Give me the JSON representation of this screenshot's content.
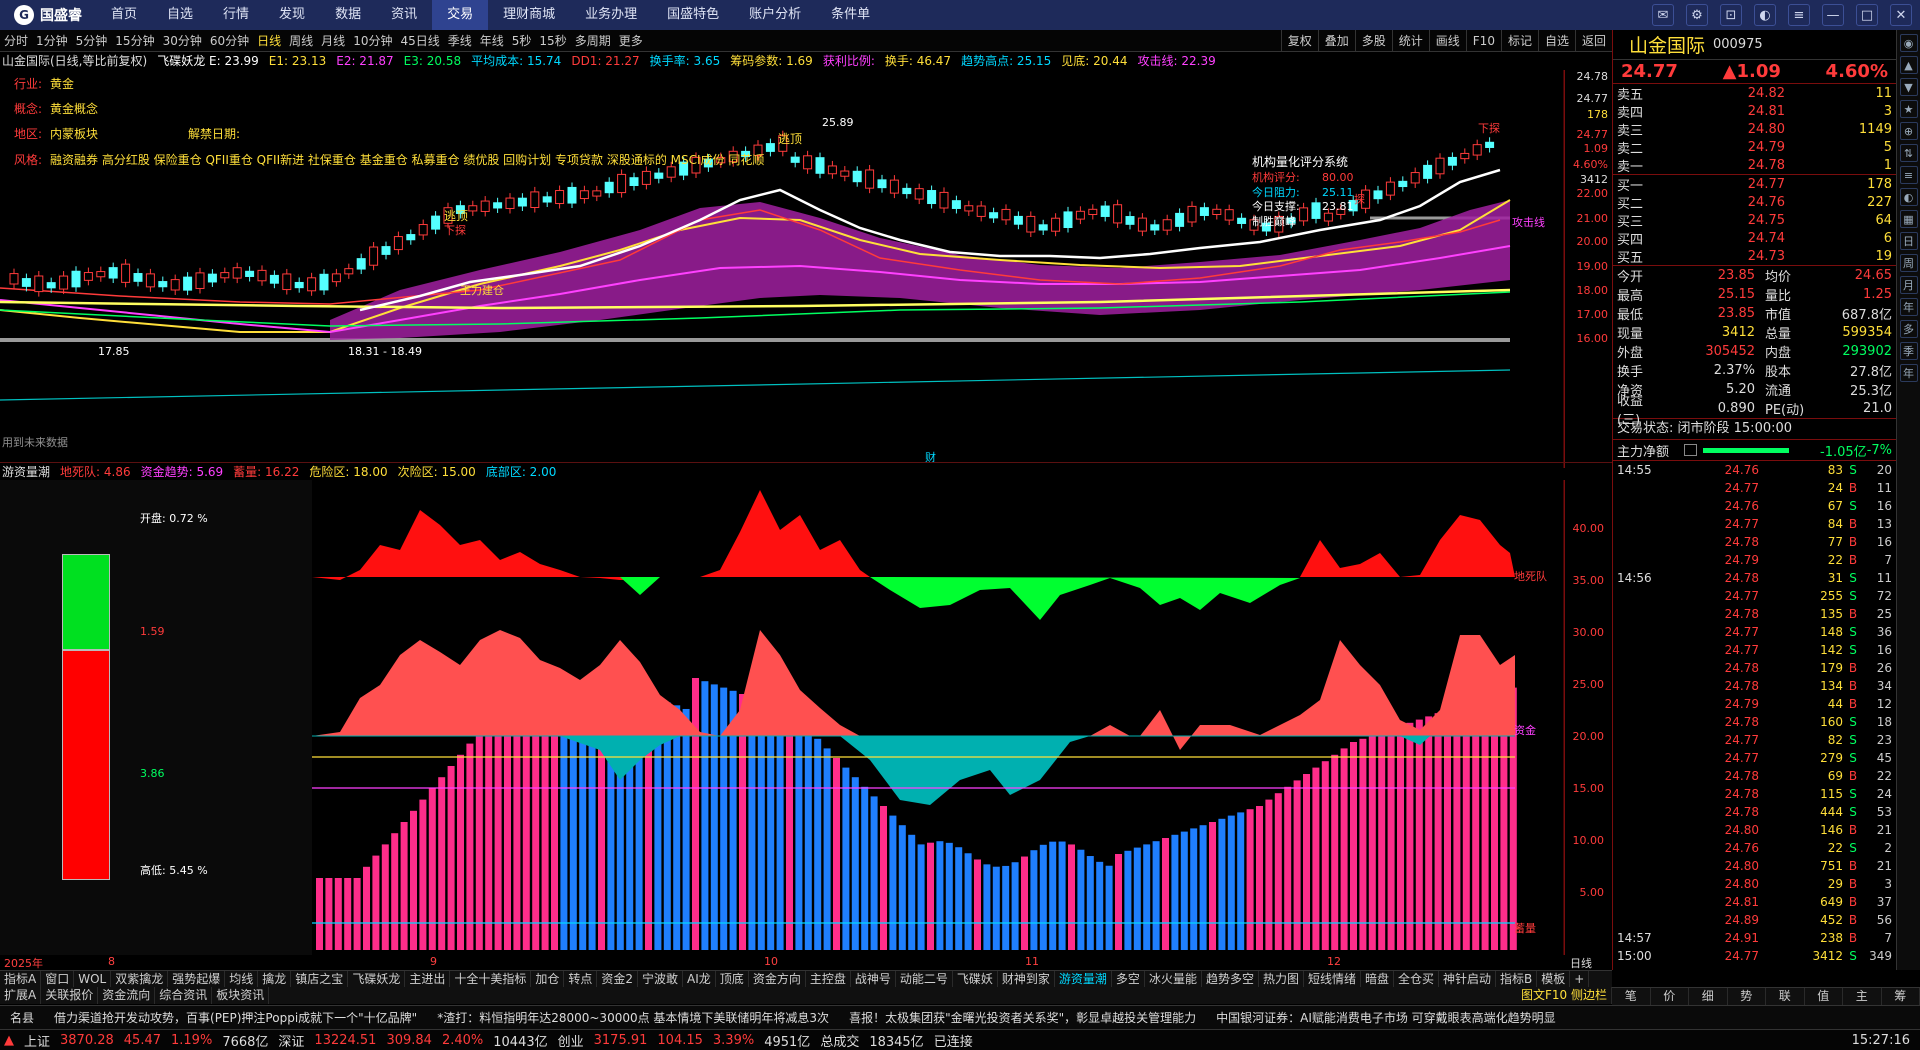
{
  "app": {
    "logo_text": "国盛睿",
    "nav": [
      "首页",
      "自选",
      "行情",
      "发现",
      "数据",
      "资讯",
      "交易",
      "理财商城",
      "业务办理",
      "国盛特色",
      "账户分析",
      "条件单"
    ],
    "nav_active": "交易"
  },
  "periods": [
    "分时",
    "1分钟",
    "5分钟",
    "15分钟",
    "30分钟",
    "60分钟",
    "日线",
    "周线",
    "月线",
    "10分钟",
    "45日线",
    "季线",
    "年线",
    "5秒",
    "15秒",
    "多周期",
    "更多"
  ],
  "period_active": "日线",
  "chart_tools": [
    "复权",
    "叠加",
    "多股",
    "统计",
    "画线",
    "F10",
    "标记",
    "自选",
    "返回"
  ],
  "indicator_line": [
    {
      "text": "山金国际(日线,等比前复权)",
      "color": "#dddddd"
    },
    {
      "text": "飞碟妖龙 E: 23.99",
      "color": "#ffffff"
    },
    {
      "text": "E1: 23.13",
      "color": "#ffdf3a"
    },
    {
      "text": "E2: 21.87",
      "color": "#ff40ff"
    },
    {
      "text": "E3: 20.58",
      "color": "#00ff60"
    },
    {
      "text": "平均成本: 15.74",
      "color": "#00d8ff"
    },
    {
      "text": "DD1: 21.27",
      "color": "#ff3b3b"
    },
    {
      "text": "换手率: 3.65",
      "color": "#00d8ff"
    },
    {
      "text": "筹码参数: 1.69",
      "color": "#ffdf3a"
    },
    {
      "text": "获利比例:",
      "color": "#ff40ff"
    },
    {
      "text": "换手: 46.47",
      "color": "#ffdf3a"
    },
    {
      "text": "趋势高点: 25.15",
      "color": "#00d8ff"
    },
    {
      "text": "见底: 20.44",
      "color": "#ffdf3a"
    },
    {
      "text": "攻击线: 22.39",
      "color": "#ff40ff"
    }
  ],
  "overlay_info": {
    "industry_label": "行业:",
    "industry": "黄金",
    "concept_label": "概念:",
    "concept": "黄金概念",
    "region_label": "地区:",
    "region": "内蒙板块",
    "unban_label": "解禁日期:",
    "style_label": "风格:",
    "style": "融资融券 高分红股 保险重仓 QFII重仓 QFII新进 社保重仓 基金重仓 私募重仓 绩优股 回购计划 专项贷款 深股通标的 MSCI成份 同花顺"
  },
  "rating_box": {
    "title": "机构量化评分系统",
    "score_label": "机构评分:",
    "score": "80.00",
    "resist_label": "今日阻力:",
    "resist": "25.11",
    "support_label": "今日支撑:",
    "support": "23.81",
    "note": "制胜巅峰"
  },
  "chart_labels": {
    "low": "17.85",
    "range": "18.31 - 18.49",
    "high": "25.89",
    "zhuli": "王力建仓",
    "fin_marker": "财",
    "attack": "攻击线",
    "escape1": "逃顶",
    "escape2": "逃顶",
    "down1": "下探",
    "down2": "下探",
    "dip": "探",
    "bottom_note": "用到未来数据"
  },
  "price_axis": [
    "24.78",
    "24.77",
    "178",
    "24.77",
    "1.09",
    "4.60%",
    "3412",
    "22.00",
    "21.00",
    "20.00",
    "19.00",
    "18.00",
    "17.00",
    "16.00"
  ],
  "sub_indicator": [
    {
      "text": "游资量潮",
      "color": "#dddddd"
    },
    {
      "text": "地死队: 4.86",
      "color": "#ff3b3b"
    },
    {
      "text": "资金趋势: 5.69",
      "color": "#ff40ff"
    },
    {
      "text": "蓄量: 16.22",
      "color": "#ff3b3b"
    },
    {
      "text": "危险区: 18.00",
      "color": "#ffdf3a"
    },
    {
      "text": "次险区: 15.00",
      "color": "#ffdf3a"
    },
    {
      "text": "底部区: 2.00",
      "color": "#00d8ff"
    }
  ],
  "sub_axis": [
    "40.00",
    "35.00",
    "30.00",
    "25.00",
    "20.00",
    "15.00",
    "10.00",
    "5.00"
  ],
  "sub_labels": {
    "a": "地死队",
    "b": "资金",
    "c": "蓄量"
  },
  "gauge": {
    "open_label": "开盘:",
    "open": "0.72 %",
    "top": "1.59",
    "bottom": "3.86",
    "high_label": "高低:",
    "high": "5.45 %"
  },
  "x_axis": [
    "2025年",
    "8",
    "9",
    "10",
    "11",
    "12",
    "日线"
  ],
  "tabs1": [
    "指标A",
    "窗口",
    "WOL",
    "双紫擒龙",
    "强势起爆",
    "均线",
    "擒龙",
    "镇店之宝",
    "飞碟妖龙",
    "主进出",
    "十全十美指标",
    "加仓",
    "转点",
    "资金2",
    "宁波敢",
    "AI龙",
    "顶底",
    "资金方向",
    "主控盘",
    "战神号",
    "动能二号",
    "飞碟妖",
    "财神到家",
    "游资量潮",
    "多空",
    "冰火量能",
    "趋势多空",
    "热力图",
    "短线情绪",
    "暗盘",
    "全仓买",
    "神针启动",
    "指标B",
    "模板",
    "+"
  ],
  "tabs1_active": "游资量潮",
  "tabs2": [
    "扩展A",
    "关联报价",
    "资金流向",
    "综合资讯",
    "板块资讯"
  ],
  "tabs2_right": "图文F10 侧边栏",
  "news": [
    "借力渠道抢开发动攻势，百事(PEP)押注Poppi成就下一个\"十亿品牌\"",
    "*渣打：料恒指明年达28000~30000点 基本情境下美联储明年将减息3次",
    "喜报！太极集团获\"金曙光投资者关系奖\"，彰显卓越投关管理能力",
    "中国银河证券：AI赋能消费电子市场 可穿戴眼表高端化趋势明显"
  ],
  "news_prefix": "名县",
  "status": {
    "sh_label": "上证",
    "sh": "3870.28",
    "sh_chg": "45.47",
    "sh_pct": "1.19%",
    "sh_amt": "7668亿",
    "sz_label": "深证",
    "sz": "13224.51",
    "sz_chg": "309.84",
    "sz_pct": "2.40%",
    "sz_amt": "10443亿",
    "cy_label": "创业",
    "cy": "3175.91",
    "cy_chg": "104.15",
    "cy_pct": "3.39%",
    "cy_amt": "4951亿",
    "total_label": "总成交",
    "total": "18345亿",
    "conn": "已连接",
    "time": "15:27:16"
  },
  "stock": {
    "name": "山金国际",
    "code": "000975",
    "price": "24.77",
    "chg": "▲1.09",
    "pct": "4.60%"
  },
  "orderbook_sell": [
    {
      "lbl": "卖五",
      "px": "24.82",
      "vol": "11"
    },
    {
      "lbl": "卖四",
      "px": "24.81",
      "vol": "3"
    },
    {
      "lbl": "卖三",
      "px": "24.80",
      "vol": "1149"
    },
    {
      "lbl": "卖二",
      "px": "24.79",
      "vol": "5"
    },
    {
      "lbl": "卖一",
      "px": "24.78",
      "vol": "1"
    }
  ],
  "orderbook_buy": [
    {
      "lbl": "买一",
      "px": "24.77",
      "vol": "178"
    },
    {
      "lbl": "买二",
      "px": "24.76",
      "vol": "227"
    },
    {
      "lbl": "买三",
      "px": "24.75",
      "vol": "64"
    },
    {
      "lbl": "买四",
      "px": "24.74",
      "vol": "6"
    },
    {
      "lbl": "买五",
      "px": "24.73",
      "vol": "19"
    }
  ],
  "stats": [
    {
      "k": "今开",
      "v": "23.85",
      "vc": "#ff3b3b",
      "k2": "均价",
      "v2": "24.65",
      "v2c": "#ff3b3b"
    },
    {
      "k": "最高",
      "v": "25.15",
      "vc": "#ff3b3b",
      "k2": "量比",
      "v2": "1.25",
      "v2c": "#ff3b3b"
    },
    {
      "k": "最低",
      "v": "23.85",
      "vc": "#ff3b3b",
      "k2": "市值",
      "v2": "687.8亿",
      "v2c": "#dddddd"
    },
    {
      "k": "现量",
      "v": "3412",
      "vc": "#ffdf3a",
      "k2": "总量",
      "v2": "599354",
      "v2c": "#ffdf3a"
    },
    {
      "k": "外盘",
      "v": "305452",
      "vc": "#ff3b3b",
      "k2": "内盘",
      "v2": "293902",
      "v2c": "#00ff60"
    },
    {
      "k": "换手",
      "v": "2.37%",
      "vc": "#dddddd",
      "k2": "股本",
      "v2": "27.8亿",
      "v2c": "#dddddd"
    },
    {
      "k": "净资",
      "v": "5.20",
      "vc": "#dddddd",
      "k2": "流通",
      "v2": "25.3亿",
      "v2c": "#dddddd"
    },
    {
      "k": "收益(三)",
      "v": "0.890",
      "vc": "#dddddd",
      "k2": "PE(动)",
      "v2": "21.0",
      "v2c": "#dddddd"
    }
  ],
  "trade_state": "交易状态: 闭市阶段 15:00:00",
  "main_flow": {
    "label": "主力净额",
    "value": "-1.05亿",
    "pct": "-7%"
  },
  "trades": [
    {
      "t": "14:55",
      "p": "24.76",
      "q": "83",
      "d": "S",
      "n": "20"
    },
    {
      "t": "",
      "p": "24.77",
      "q": "24",
      "d": "B",
      "n": "11"
    },
    {
      "t": "",
      "p": "24.76",
      "q": "67",
      "d": "S",
      "n": "16"
    },
    {
      "t": "",
      "p": "24.77",
      "q": "84",
      "d": "B",
      "n": "13"
    },
    {
      "t": "",
      "p": "24.78",
      "q": "77",
      "d": "B",
      "n": "16"
    },
    {
      "t": "",
      "p": "24.79",
      "q": "22",
      "d": "B",
      "n": "7"
    },
    {
      "t": "14:56",
      "p": "24.78",
      "q": "31",
      "d": "S",
      "n": "11"
    },
    {
      "t": "",
      "p": "24.77",
      "q": "255",
      "d": "S",
      "n": "72"
    },
    {
      "t": "",
      "p": "24.78",
      "q": "135",
      "d": "B",
      "n": "25"
    },
    {
      "t": "",
      "p": "24.77",
      "q": "148",
      "d": "S",
      "n": "36"
    },
    {
      "t": "",
      "p": "24.77",
      "q": "142",
      "d": "S",
      "n": "16"
    },
    {
      "t": "",
      "p": "24.78",
      "q": "179",
      "d": "B",
      "n": "26"
    },
    {
      "t": "",
      "p": "24.78",
      "q": "134",
      "d": "B",
      "n": "34"
    },
    {
      "t": "",
      "p": "24.79",
      "q": "44",
      "d": "B",
      "n": "12"
    },
    {
      "t": "",
      "p": "24.78",
      "q": "160",
      "d": "S",
      "n": "18"
    },
    {
      "t": "",
      "p": "24.77",
      "q": "82",
      "d": "S",
      "n": "23"
    },
    {
      "t": "",
      "p": "24.77",
      "q": "279",
      "d": "S",
      "n": "45"
    },
    {
      "t": "",
      "p": "24.78",
      "q": "69",
      "d": "B",
      "n": "22"
    },
    {
      "t": "",
      "p": "24.78",
      "q": "115",
      "d": "S",
      "n": "24"
    },
    {
      "t": "",
      "p": "24.78",
      "q": "444",
      "d": "S",
      "n": "53"
    },
    {
      "t": "",
      "p": "24.80",
      "q": "146",
      "d": "B",
      "n": "21"
    },
    {
      "t": "",
      "p": "24.76",
      "q": "22",
      "d": "S",
      "n": "2"
    },
    {
      "t": "",
      "p": "24.80",
      "q": "751",
      "d": "B",
      "n": "21"
    },
    {
      "t": "",
      "p": "24.80",
      "q": "29",
      "d": "B",
      "n": "3"
    },
    {
      "t": "",
      "p": "24.81",
      "q": "649",
      "d": "B",
      "n": "37"
    },
    {
      "t": "",
      "p": "24.89",
      "q": "452",
      "d": "B",
      "n": "56"
    },
    {
      "t": "14:57",
      "p": "24.91",
      "q": "238",
      "d": "B",
      "n": "7"
    },
    {
      "t": "15:00",
      "p": "24.77",
      "q": "3412",
      "d": "S",
      "n": "349"
    }
  ],
  "right_tabs": [
    "笔",
    "价",
    "细",
    "势",
    "联",
    "值",
    "主",
    "筹"
  ],
  "right_tools": [
    "◉",
    "▲",
    "▼",
    "★",
    "⊕",
    "⇅",
    "≡",
    "◐",
    "▦",
    "日",
    "周",
    "月",
    "年",
    "多",
    "季",
    "年"
  ]
}
